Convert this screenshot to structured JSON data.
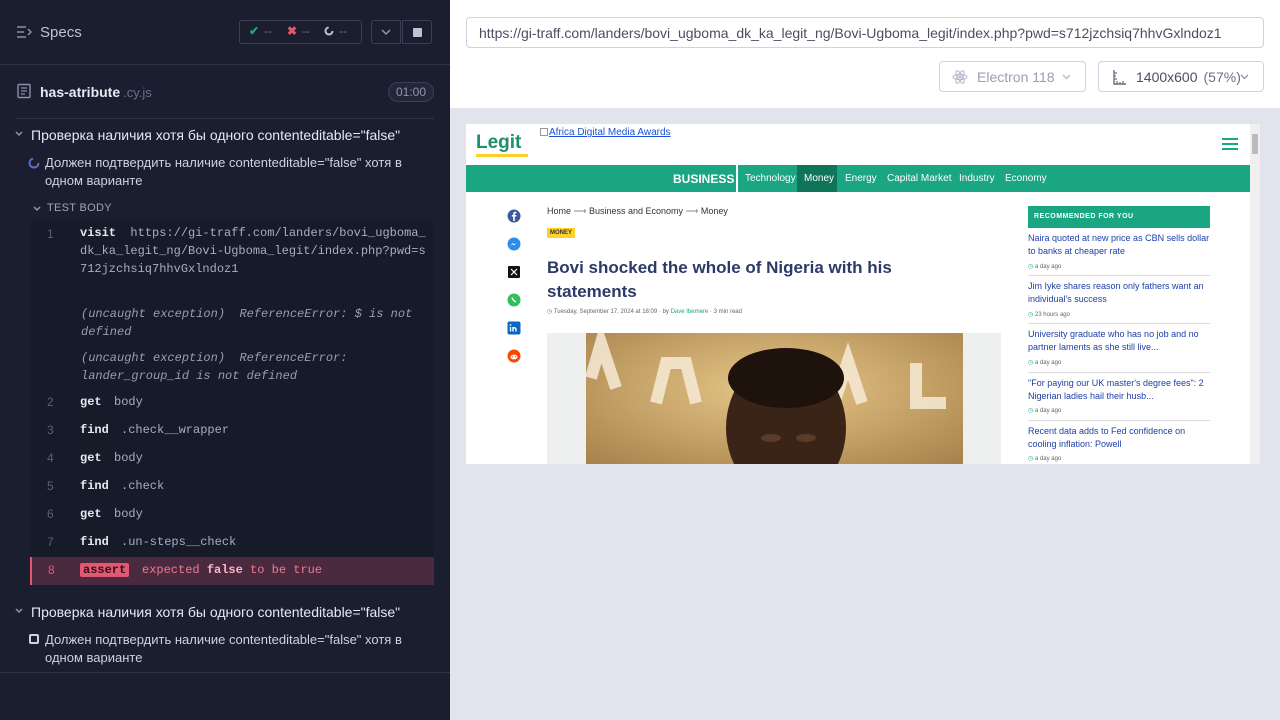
{
  "reporter": {
    "title": "Specs",
    "stats": {
      "passed": "--",
      "failed": "--",
      "pending": "--"
    },
    "file": {
      "name": "has-atribute",
      "ext": ".cy.js",
      "duration": "01:00"
    },
    "suites": [
      {
        "title": "Проверка наличия хотя бы одного contenteditable=\"false\"",
        "test": {
          "title": "Должен подтвердить наличие contenteditable=\"false\" хотя в одном варианте",
          "state": "running",
          "body_label": "TEST BODY",
          "commands": [
            {
              "num": "1",
              "name": "visit",
              "arg": "https://gi-traff.com/landers/bovi_ugboma_dk_ka_legit_ng/Bovi-Ugboma_legit/index.php?pwd=s712jzchsiq7hhvGxlndoz1"
            },
            {
              "name": "(uncaught exception)",
              "arg": "ReferenceError: $ is not defined"
            },
            {
              "name": "(uncaught exception)",
              "arg": "ReferenceError: lander_group_id is not defined"
            },
            {
              "num": "2",
              "name": "get",
              "arg": "body"
            },
            {
              "num": "3",
              "name": "find",
              "arg": ".check__wrapper"
            },
            {
              "num": "4",
              "name": "get",
              "arg": "body"
            },
            {
              "num": "5",
              "name": "find",
              "arg": ".check"
            },
            {
              "num": "6",
              "name": "get",
              "arg": "body"
            },
            {
              "num": "7",
              "name": "find",
              "arg": ".un-steps__check"
            },
            {
              "num": "8",
              "name": "assert",
              "msg_pre": "expected",
              "msg_val": "false",
              "msg_post": "to be true"
            }
          ]
        }
      },
      {
        "title": "Проверка наличия хотя бы одного contenteditable=\"false\"",
        "test": {
          "title": "Должен подтвердить наличие contenteditable=\"false\" хотя в одном варианте",
          "state": "pending"
        }
      }
    ]
  },
  "aut": {
    "url": "https://gi-traff.com/landers/bovi_ugboma_dk_ka_legit_ng/Bovi-Ugboma_legit/index.php?pwd=s712jzchsiq7hhvGxlndoz1",
    "browser": "Electron 118",
    "viewport": "1400x600",
    "scale": "(57%)"
  },
  "site": {
    "logo": "Legit",
    "award_alt": "Africa Digital Media Awards",
    "nav": {
      "section": "BUSINESS",
      "items": [
        "Technology",
        "Money",
        "Energy",
        "Capital Market",
        "Industry",
        "Economy"
      ],
      "active": "Money"
    },
    "share_icons": [
      "facebook-icon",
      "messenger-icon",
      "x-icon",
      "whatsapp-icon",
      "linkedin-icon",
      "reddit-icon"
    ],
    "breadcrumb": [
      "Home",
      "Business and Economy",
      "Money"
    ],
    "tag": "MONEY",
    "headline": "Bovi shocked the whole of Nigeria with his statements",
    "meta_date": "Tuesday, September 17, 2024 at 18:09",
    "meta_by": "by",
    "meta_author": "Dave Ibemere",
    "meta_read": "3 min read",
    "recommended": {
      "heading": "RECOMMENDED FOR YOU",
      "items": [
        {
          "title": "Naira quoted at new price as CBN sells dollar to banks at cheaper rate",
          "time": "a day ago"
        },
        {
          "title": "Jim Iyke shares reason only fathers want an individual's success",
          "time": "23 hours ago"
        },
        {
          "title": "University graduate who has no job and no partner laments as she still live...",
          "time": "a day ago"
        },
        {
          "title": "\"For paying our UK master's degree fees\": 2 Nigerian ladies hail their husb...",
          "time": "a day ago"
        },
        {
          "title": "Recent data adds to Fed confidence on cooling inflation: Powell",
          "time": "a day ago"
        }
      ]
    }
  }
}
